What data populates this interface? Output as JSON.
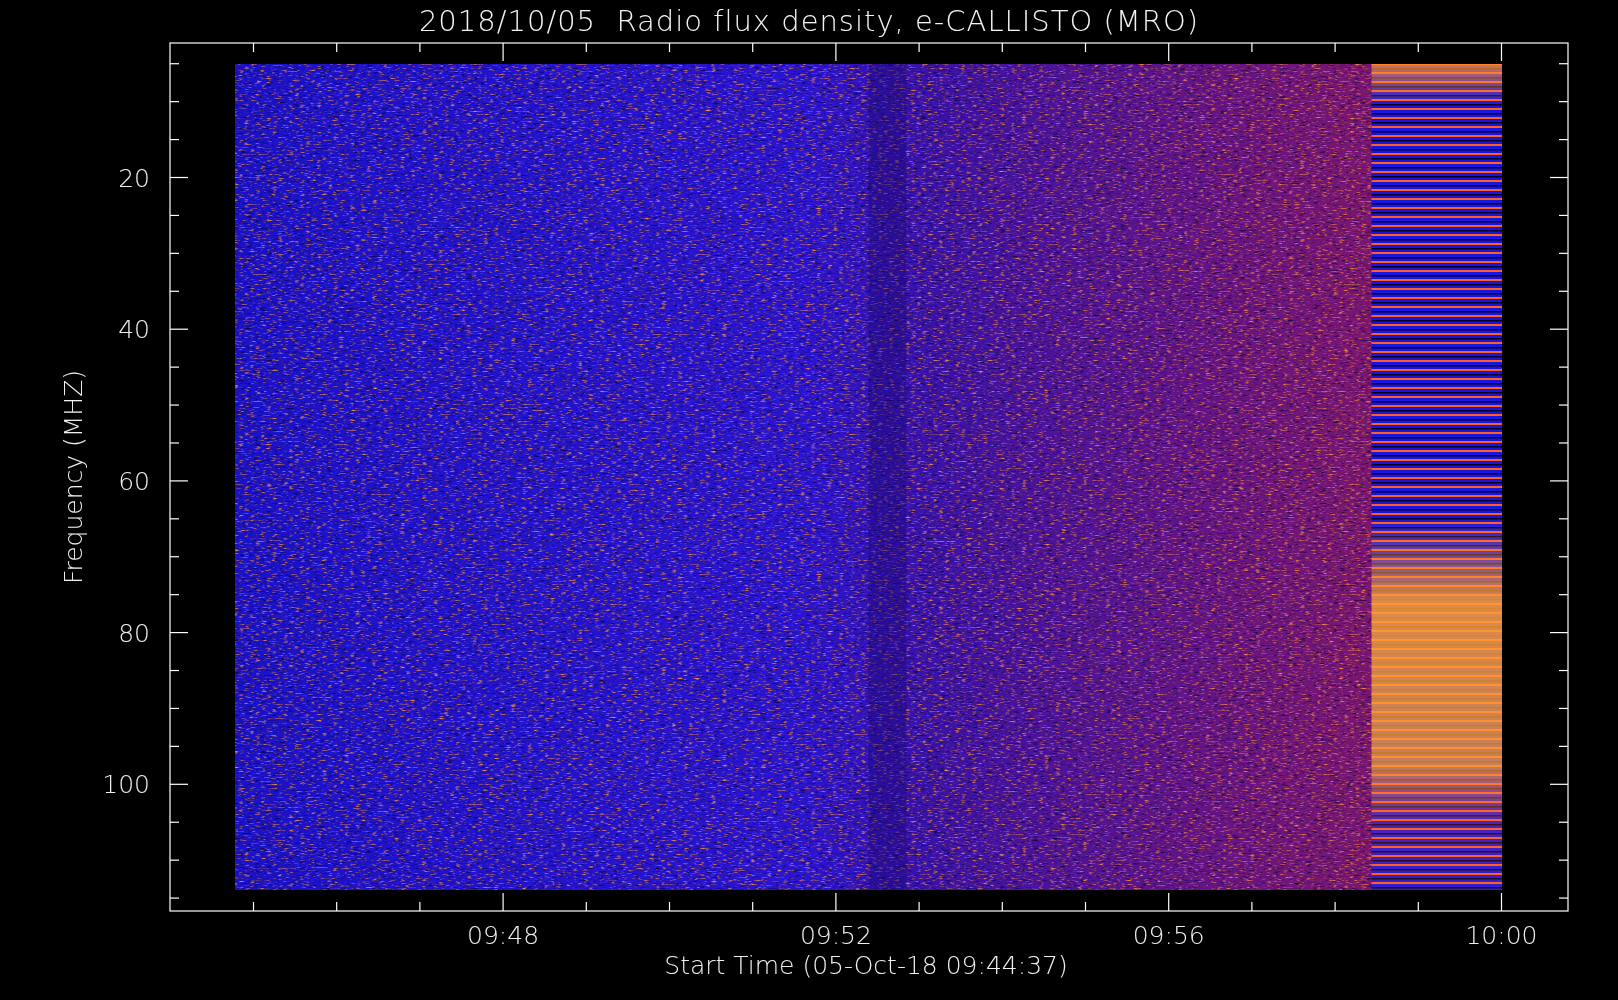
{
  "title": "2018/10/05  Radio flux density, e-CALLISTO (MRO)",
  "plot": {
    "ylabel": "Frequency (MHZ)",
    "xlabel": "Start Time (05-Oct-18 09:44:37)",
    "yticks": [
      "20",
      "40",
      "60",
      "80",
      "100"
    ],
    "xticks": [
      "09:48",
      "09:52",
      "09:56",
      "10:00"
    ]
  }
}
